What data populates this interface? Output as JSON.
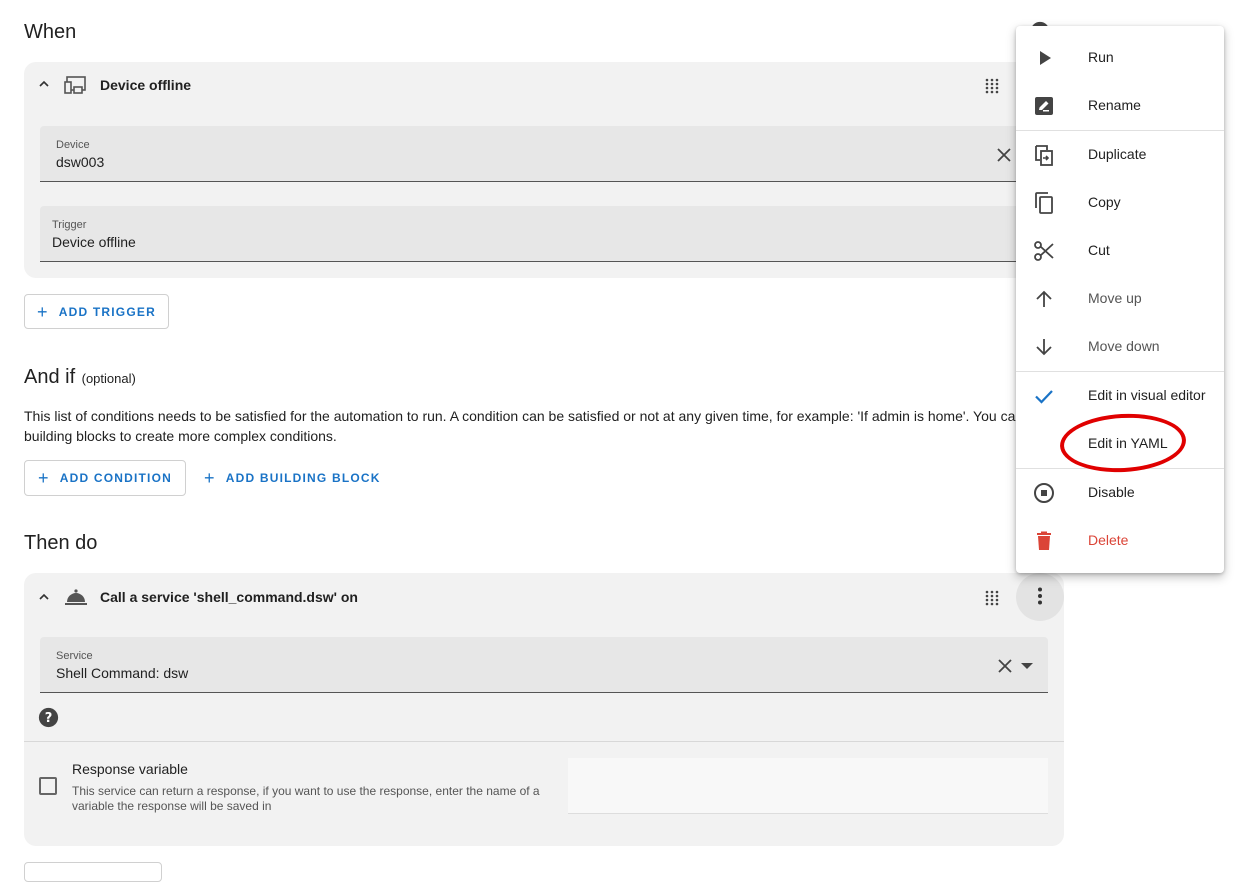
{
  "when": {
    "heading": "When",
    "trigger_card": {
      "title": "Device offline",
      "device_field": {
        "label": "Device",
        "value": "dsw003"
      },
      "trigger_field": {
        "label": "Trigger",
        "value": "Device offline"
      }
    },
    "add_trigger_label": "ADD TRIGGER"
  },
  "and_if": {
    "heading": "And if",
    "optional": "(optional)",
    "description_line1": "This list of conditions needs to be satisfied for the automation to run. A condition can be satisfied or not at any given time, for example: 'If admin is home'. You ca",
    "description_line2": "building blocks to create more complex conditions.",
    "add_condition_label": "ADD CONDITION",
    "add_building_block_label": "ADD BUILDING BLOCK"
  },
  "then_do": {
    "heading": "Then do",
    "action_card": {
      "title": "Call a service 'shell_command.dsw' on",
      "service_field": {
        "label": "Service",
        "value": "Shell Command: dsw"
      },
      "response": {
        "title": "Response variable",
        "description_line1": "This service can return a response, if you want to use the response, enter the name of a",
        "description_line2": "variable the response will be saved in"
      }
    }
  },
  "menu": {
    "items": [
      {
        "label": "Run",
        "icon": "play-icon"
      },
      {
        "label": "Rename",
        "icon": "rename-icon"
      },
      {
        "label": "Duplicate",
        "icon": "duplicate-icon"
      },
      {
        "label": "Copy",
        "icon": "copy-icon"
      },
      {
        "label": "Cut",
        "icon": "scissors-icon"
      },
      {
        "label": "Move up",
        "icon": "arrow-up-icon"
      },
      {
        "label": "Move down",
        "icon": "arrow-down-icon"
      },
      {
        "label": "Edit in visual editor",
        "icon": "check-icon"
      },
      {
        "label": "Edit in YAML",
        "icon": ""
      },
      {
        "label": "Disable",
        "icon": "stop-circle-icon"
      },
      {
        "label": "Delete",
        "icon": "trash-icon"
      }
    ],
    "accent_color": "#1a73c6",
    "danger_color": "#db4437",
    "highlight_color": "#e00000"
  }
}
